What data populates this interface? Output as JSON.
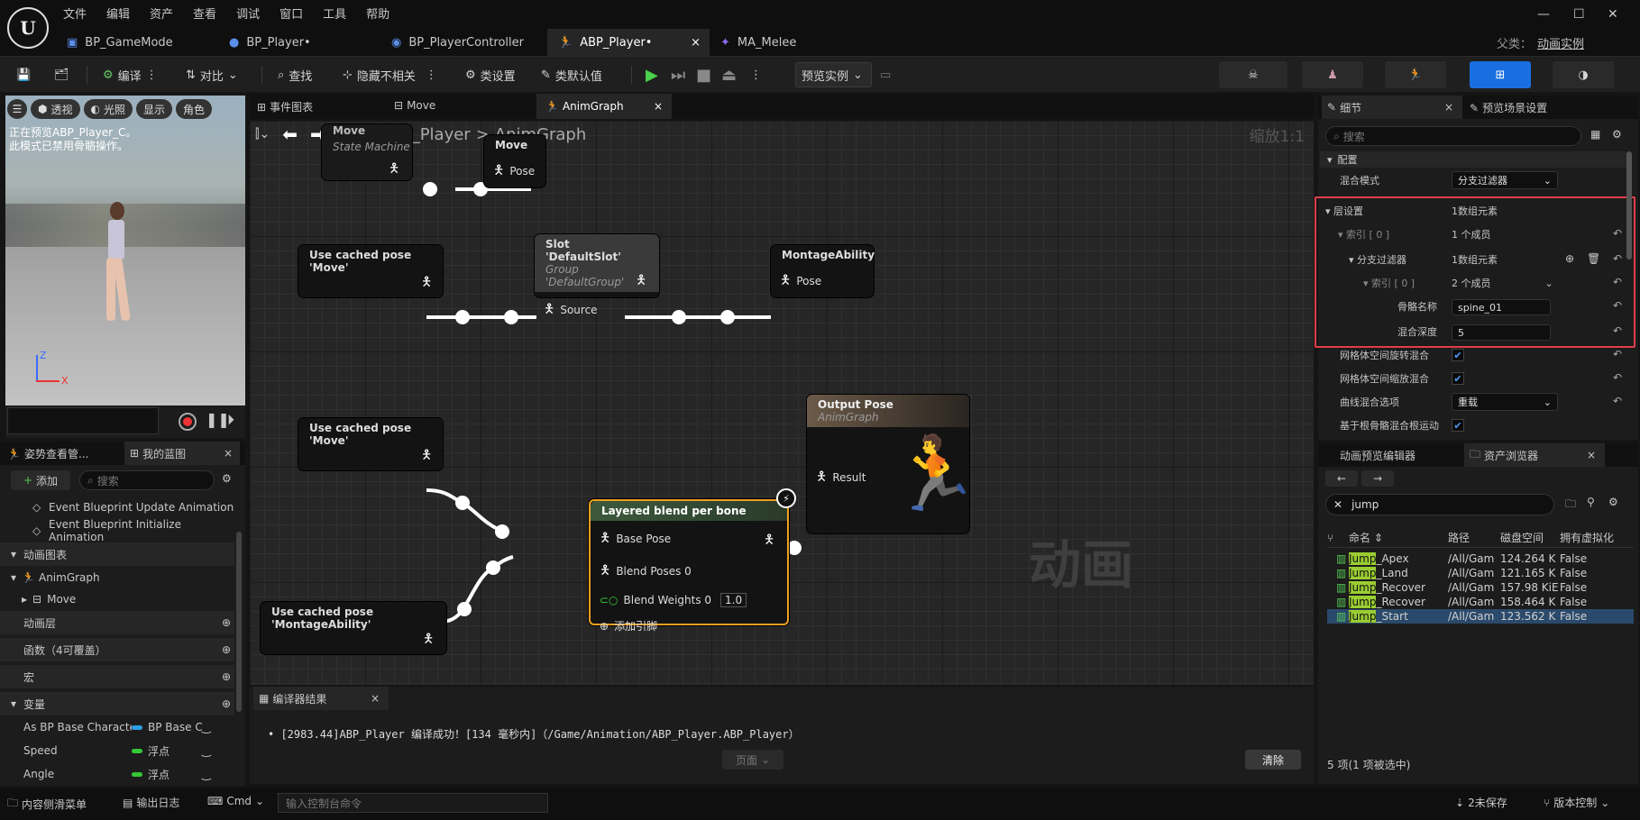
{
  "menu": [
    "文件",
    "编辑",
    "资产",
    "查看",
    "调试",
    "窗口",
    "工具",
    "帮助"
  ],
  "tabs": [
    {
      "label": "BP_GameMode"
    },
    {
      "label": "BP_Player•"
    },
    {
      "label": "BP_PlayerController"
    },
    {
      "label": "ABP_Player•",
      "close": "×"
    },
    {
      "label": "MA_Melee"
    }
  ],
  "parent": {
    "label": "父类：",
    "value": "动画实例"
  },
  "window": {
    "minimize": "—",
    "maximize": "☐",
    "close": "✕"
  },
  "toolbar": {
    "compile": "编译",
    "diff": "对比",
    "find": "查找",
    "hide": "隐藏不相关",
    "class_settings": "类设置",
    "class_defaults": "类默认值",
    "preview": "预览实例"
  },
  "viewport": {
    "perspective": "透视",
    "lit": "光照",
    "show": "显示",
    "character": "角色",
    "notice1": "正在预览ABP_Player_C。",
    "notice2": "此模式已禁用骨骼操作。",
    "axis_z": "Z",
    "axis_x": "X"
  },
  "graph_tabs": {
    "event": "事件图表",
    "move": "Move",
    "anim": "AnimGraph"
  },
  "breadcrumb": {
    "root": "ABP_Player",
    "sep": ">",
    "current": "AnimGraph",
    "zoom": "缩放1:1"
  },
  "nodes": {
    "sm": {
      "title": "Move",
      "sub": "State Machine"
    },
    "move": {
      "title": "Move",
      "pin": "Pose"
    },
    "cached1": {
      "title": "Use cached pose 'Move'"
    },
    "slot": {
      "title": "Slot 'DefaultSlot'",
      "sub": "Group 'DefaultGroup'",
      "pin": "Source"
    },
    "montage": {
      "title": "MontageAbility",
      "pin": "Pose"
    },
    "cached2": {
      "title": "Use cached pose 'Move'"
    },
    "cached3": {
      "title": "Use cached pose 'MontageAbility'"
    },
    "layered": {
      "title": "Layered blend per bone",
      "base": "Base Pose",
      "poses": "Blend Poses 0",
      "weights": "Blend Weights 0",
      "weight_value": "1.0",
      "add": "添加引脚"
    },
    "output": {
      "title": "Output Pose",
      "sub": "AnimGraph",
      "pin": "Result"
    }
  },
  "watermark": "动画",
  "compiler": {
    "tab": "编译器结果",
    "message": "[2983.44]ABP_Player 编译成功！[134 毫秒内]（/Game/Animation/ABP_Player.ABP_Player）",
    "page": "页面",
    "clear": "清除"
  },
  "details": {
    "tab1": "细节",
    "tab2": "预览场景设置",
    "search": "搜索",
    "section": "配置",
    "blend_mode": {
      "label": "混合模式",
      "value": "分支过滤器"
    },
    "layer_setup": {
      "label": "层设置",
      "value": "1数组元素"
    },
    "index0": {
      "label": "索引 [ 0 ]",
      "value": "1 个成员"
    },
    "branch_filters": {
      "label": "分支过滤器",
      "value": "1数组元素"
    },
    "index0b": {
      "label": "索引 [ 0 ]",
      "value": "2 个成员"
    },
    "bone_name": {
      "label": "骨骼名称",
      "value": "spine_01"
    },
    "blend_depth": {
      "label": "混合深度",
      "value": "5"
    },
    "mesh_rot": {
      "label": "网格体空间旋转混合"
    },
    "mesh_scale": {
      "label": "网格体空间缩放混合"
    },
    "curve": {
      "label": "曲线混合选项",
      "value": "重载"
    },
    "root": {
      "label": "基于根骨骼混合根运动"
    }
  },
  "asset_browser": {
    "tab1": "动画预览编辑器",
    "tab2": "资产浏览器",
    "search": "jump",
    "cols": [
      "命名",
      "路径",
      "磁盘空间",
      "拥有虚拟化"
    ],
    "rows": [
      {
        "pre": "Jump",
        "post": "_Apex",
        "path": "/All/Gam",
        "size": "124.264 K",
        "virt": "False"
      },
      {
        "pre": "Jump",
        "post": "_Land",
        "path": "/All/Gam",
        "size": "121.165 K",
        "virt": "False"
      },
      {
        "pre": "Jump",
        "post": "_Recover",
        "path": "/All/Gam",
        "size": "157.98 KiE",
        "virt": "False"
      },
      {
        "pre": "Jump",
        "post": "_Recover",
        "path": "/All/Gam",
        "size": "158.464 K",
        "virt": "False"
      },
      {
        "pre": "Jump",
        "post": "_Start",
        "path": "/All/Gam",
        "size": "123.562 K",
        "virt": "False"
      }
    ],
    "footer": "5 项(1 项被选中)"
  },
  "left": {
    "tab1": "姿势查看管...",
    "tab2": "我的蓝图",
    "add": "添加",
    "search": "搜索",
    "event1": "Event Blueprint Update Animation",
    "event2": "Event Blueprint Initialize Animation",
    "anim_graphs": "动画图表",
    "animgraph": "AnimGraph",
    "move": "Move",
    "anim_layers": "动画层",
    "functions": "函数（4可覆盖）",
    "macros": "宏",
    "variables": "变量",
    "vars": [
      {
        "name": "As BP Base Characte",
        "type": "BP Base C",
        "color": "#2aa0e8"
      },
      {
        "name": "Speed",
        "type": "浮点",
        "color": "#34c834"
      },
      {
        "name": "Angle",
        "type": "浮点",
        "color": "#34c834"
      }
    ]
  },
  "status": {
    "drawer": "内容侧滑菜单",
    "log": "输出日志",
    "cmd": "Cmd",
    "console": "输入控制台命令",
    "unsaved": "2未保存",
    "source": "版本控制"
  }
}
